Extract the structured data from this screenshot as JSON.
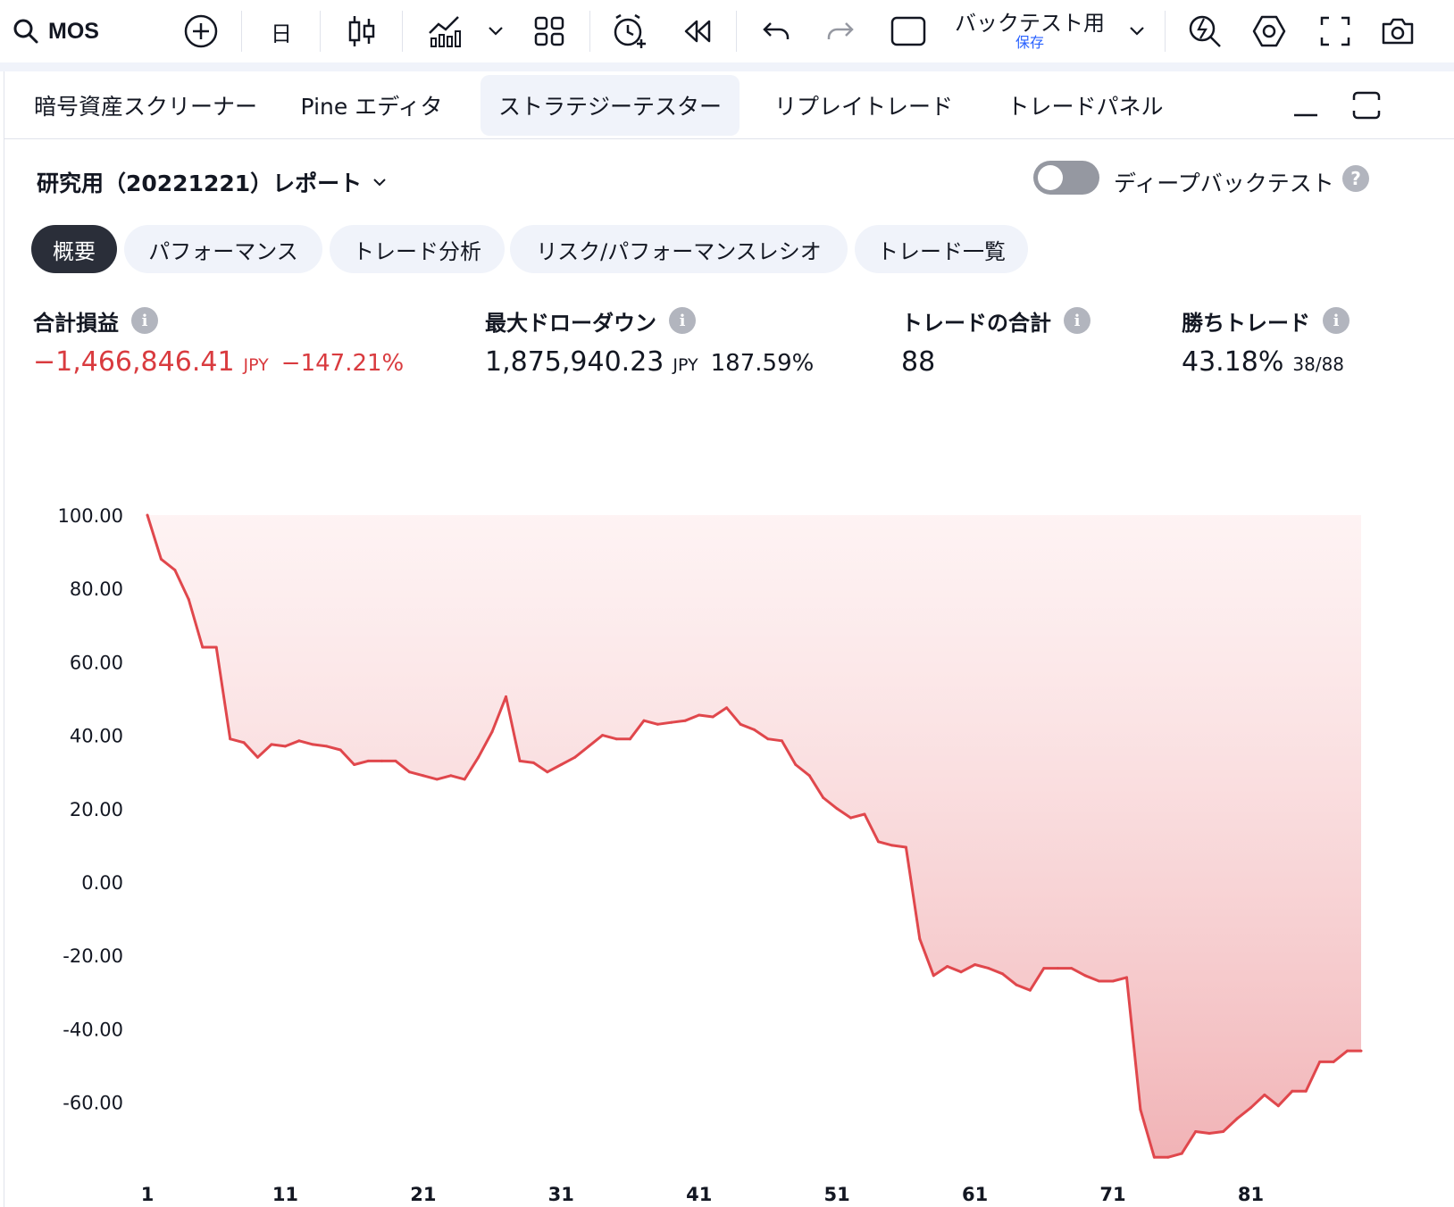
{
  "toolbar": {
    "symbol": "MOS",
    "interval": "日",
    "layout_name": "バックテスト用",
    "layout_status": "保存"
  },
  "tabs": [
    {
      "label": "暗号資産スクリーナー"
    },
    {
      "label": "Pine エディタ"
    },
    {
      "label": "ストラテジーテスター",
      "active": true
    },
    {
      "label": "リプレイトレード"
    },
    {
      "label": "トレードパネル"
    }
  ],
  "report": {
    "title": "研究用（20221221）レポート",
    "deep_backtest_label": "ディープバックテスト",
    "deep_backtest_enabled": false
  },
  "subtabs": [
    {
      "label": "概要",
      "active": true
    },
    {
      "label": "パフォーマンス"
    },
    {
      "label": "トレード分析"
    },
    {
      "label": "リスク/パフォーマンスレシオ"
    },
    {
      "label": "トレード一覧"
    }
  ],
  "stats": {
    "net_profit": {
      "label": "合計損益",
      "value": "−1,466,846.41",
      "unit": "JPY",
      "pct": "−147.21%"
    },
    "max_drawdown": {
      "label": "最大ドローダウン",
      "value": "1,875,940.23",
      "unit": "JPY",
      "pct": "187.59%"
    },
    "total_trades": {
      "label": "トレードの合計",
      "value": "88"
    },
    "win_trades": {
      "label": "勝ちトレード",
      "value": "43.18%",
      "sub": "38/88"
    }
  },
  "colors": {
    "negative": "#d93b3f",
    "line": "#e0474c",
    "fill_top": "#fde9ea",
    "fill_bottom": "#f1b3b6",
    "pill_active": "#2a2e39"
  },
  "chart_data": {
    "type": "area",
    "xlabel": "",
    "ylabel": "",
    "x_ticks": [
      "1",
      "11",
      "21",
      "31",
      "41",
      "51",
      "61",
      "71",
      "81"
    ],
    "y_ticks": [
      "100.00",
      "80.00",
      "60.00",
      "40.00",
      "20.00",
      "0.00",
      "-20.00",
      "-40.00",
      "-60.00"
    ],
    "ylim": [
      -75,
      100
    ],
    "xlim": [
      1,
      89
    ],
    "grid": false,
    "legend": "none",
    "series": [
      {
        "x": [
          1,
          2,
          3,
          4,
          5,
          6,
          7,
          8,
          9,
          10,
          11,
          12,
          13,
          14,
          15,
          16,
          17,
          18,
          19,
          20,
          21,
          22,
          23,
          24,
          25,
          26,
          27,
          28,
          29,
          30,
          31,
          32,
          33,
          34,
          35,
          36,
          37,
          38,
          39,
          40,
          41,
          42,
          43,
          44,
          45,
          46,
          47,
          48,
          49,
          50,
          51,
          52,
          53,
          54,
          55,
          56,
          57,
          58,
          59,
          60,
          61,
          62,
          63,
          64,
          65,
          66,
          67,
          68,
          69,
          70,
          71,
          72,
          73,
          74,
          75,
          76,
          77,
          78,
          79,
          80,
          81,
          82,
          83,
          84,
          85,
          86,
          87,
          88,
          89
        ],
        "values": [
          100,
          88,
          85,
          77,
          64,
          64,
          39,
          38,
          34,
          37.5,
          37,
          38.5,
          37.5,
          37,
          36,
          32,
          33,
          33,
          33,
          30,
          29,
          28,
          29,
          28,
          34,
          41,
          50.5,
          33,
          32.5,
          30,
          32,
          34,
          37,
          40,
          39,
          39,
          44,
          43,
          43.5,
          44,
          45.5,
          45,
          47.5,
          43,
          41.5,
          39,
          38.5,
          32,
          29,
          23,
          20,
          17.5,
          18.5,
          11,
          10,
          9.5,
          -15.5,
          -25.5,
          -23,
          -24.5,
          -22.5,
          -23.5,
          -25,
          -28,
          -29.5,
          -23.5,
          -23.5,
          -23.5,
          -25.5,
          -27,
          -27,
          -26,
          -62,
          -75,
          -75,
          -74,
          -68,
          -68.5,
          -68,
          -64.5,
          -61.5,
          -58,
          -61,
          -57,
          -57,
          -49,
          -49,
          -46,
          -46
        ]
      }
    ]
  }
}
